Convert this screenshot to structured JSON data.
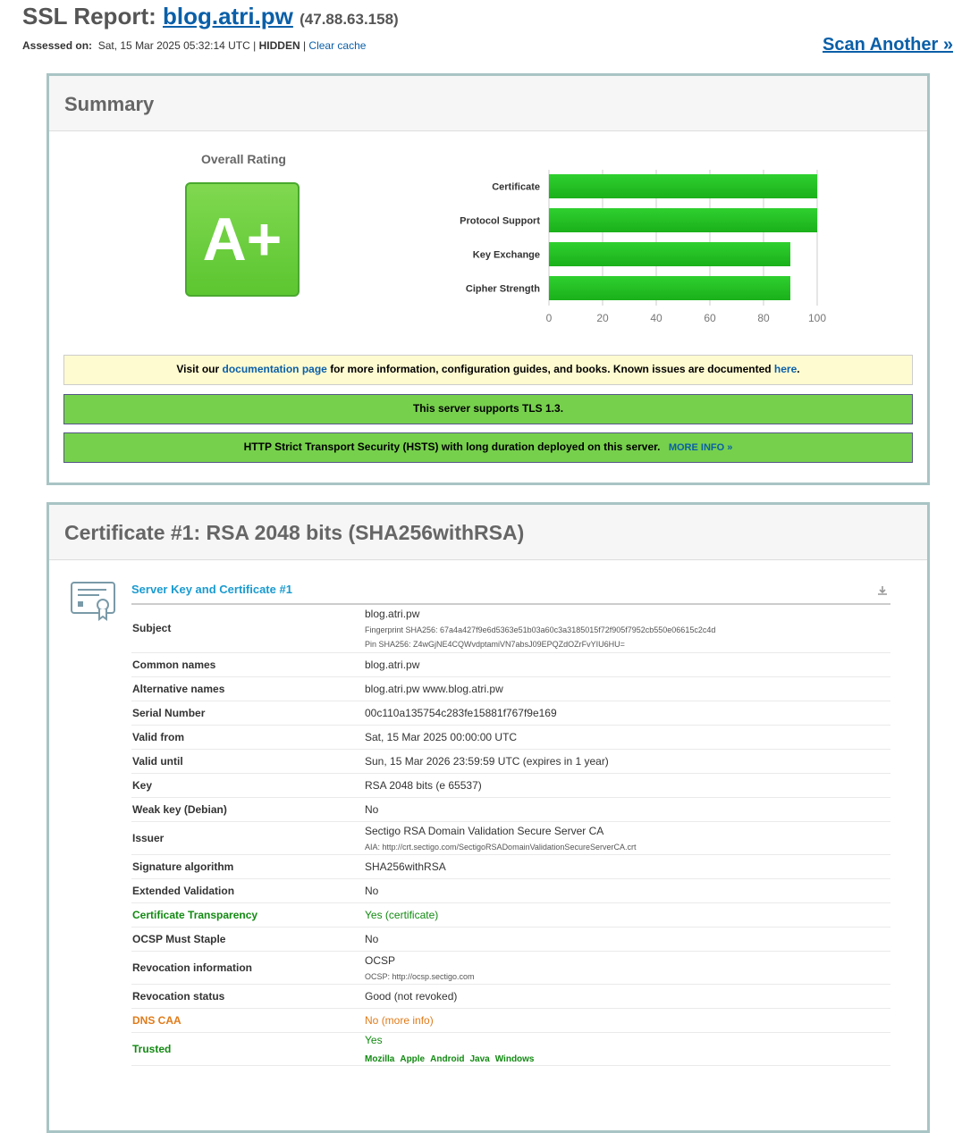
{
  "header": {
    "title_prefix": "SSL Report:",
    "host": "blog.atri.pw",
    "ip": "(47.88.63.158)",
    "assessed_label": "Assessed on:",
    "assessed_value": "Sat, 15 Mar 2025 05:32:14 UTC",
    "hidden": "HIDDEN",
    "clear_cache": "Clear cache",
    "scan_another": "Scan Another »"
  },
  "summary": {
    "heading": "Summary",
    "overall_rating_label": "Overall Rating",
    "grade": "A+",
    "grade_color": "#6ccf3c",
    "notice_doc": {
      "pre": "Visit our",
      "link": "documentation page",
      "mid": "for more information, configuration guides, and books. Known issues are documented",
      "link2": "here",
      "end": "."
    },
    "notice_tls": "This server supports TLS 1.3.",
    "notice_hsts": "HTTP Strict Transport Security (HSTS) with long duration deployed on this server.",
    "notice_hsts_link": "MORE INFO »"
  },
  "chart_data": {
    "type": "bar",
    "orientation": "horizontal",
    "categories": [
      "Certificate",
      "Protocol Support",
      "Key Exchange",
      "Cipher Strength"
    ],
    "values": [
      100,
      100,
      90,
      90
    ],
    "xlim": [
      0,
      100
    ],
    "ticks": [
      0,
      20,
      40,
      60,
      80,
      100
    ],
    "bar_color": "#1ab01a",
    "grid": true
  },
  "certificate": {
    "heading": "Certificate #1: RSA 2048 bits (SHA256withRSA)",
    "section_title": "Server Key and Certificate #1",
    "rows": [
      {
        "key": "Subject",
        "value": "blog.atri.pw",
        "subs": [
          "Fingerprint SHA256: 67a4a427f9e6d5363e51b03a60c3a3185015f72f905f7952cb550e06615c2c4d",
          "Pin SHA256: Z4wGjNE4CQWvdptamiVN7absJ09EPQZdOZrFvYIU6HU="
        ]
      },
      {
        "key": "Common names",
        "value": "blog.atri.pw"
      },
      {
        "key": "Alternative names",
        "value": "blog.atri.pw www.blog.atri.pw"
      },
      {
        "key": "Serial Number",
        "value": "00c110a135754c283fe15881f767f9e169"
      },
      {
        "key": "Valid from",
        "value": "Sat, 15 Mar 2025 00:00:00 UTC"
      },
      {
        "key": "Valid until",
        "value": "Sun, 15 Mar 2026 23:59:59 UTC (expires in 1 year)"
      },
      {
        "key": "Key",
        "value": "RSA 2048 bits (e 65537)"
      },
      {
        "key": "Weak key (Debian)",
        "value": "No"
      },
      {
        "key": "Issuer",
        "value": "Sectigo RSA Domain Validation Secure Server CA",
        "subs": [
          "AIA: http://crt.sectigo.com/SectigoRSADomainValidationSecureServerCA.crt"
        ]
      },
      {
        "key": "Signature algorithm",
        "value": "SHA256withRSA"
      },
      {
        "key": "Extended Validation",
        "value": "No"
      },
      {
        "key": "Certificate Transparency",
        "value": "Yes (certificate)",
        "status": "green"
      },
      {
        "key": "OCSP Must Staple",
        "value": "No"
      },
      {
        "key": "Revocation information",
        "value": "OCSP",
        "subs": [
          "OCSP: http://ocsp.sectigo.com"
        ]
      },
      {
        "key": "Revocation status",
        "value": "Good (not revoked)"
      },
      {
        "key": "DNS CAA",
        "value": "No",
        "link": "(more info)",
        "status": "orange"
      },
      {
        "key": "Trusted",
        "value": "Yes",
        "stores": [
          "Mozilla",
          "Apple",
          "Android",
          "Java",
          "Windows"
        ],
        "status": "green"
      }
    ]
  },
  "colors": {
    "accent": "#0a5fa8",
    "ok_green": "#128a12",
    "warn_orange": "#e07b1a",
    "box_border": "#a9c4c4"
  }
}
